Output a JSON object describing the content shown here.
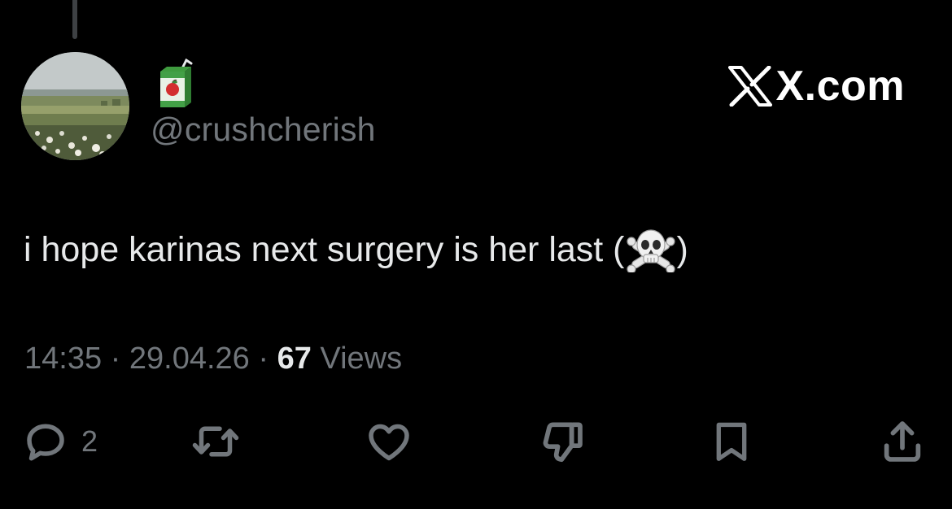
{
  "post": {
    "author": {
      "display_name_icon": "juice-box-emoji",
      "handle": "@crushcherish"
    },
    "brand": {
      "icon": "x-logo-icon",
      "text": "X.com"
    },
    "text_before": "i hope karinas next surgery is her last (",
    "text_emoji": "skull-and-crossbones-emoji",
    "text_after": ")",
    "time": "14:35",
    "separator": "·",
    "date": "29.04.26",
    "views_count": "67",
    "views_label": "Views"
  },
  "actions": {
    "reply": {
      "icon": "reply-bubble-icon",
      "count": "2"
    },
    "repost": {
      "icon": "repost-icon"
    },
    "like": {
      "icon": "heart-icon"
    },
    "dislike": {
      "icon": "thumbs-down-icon"
    },
    "bookmark": {
      "icon": "bookmark-icon"
    },
    "share": {
      "icon": "share-icon"
    }
  },
  "colors": {
    "background": "#000000",
    "primary_text": "#e7e9ea",
    "secondary_text": "#71767b",
    "thread_line": "#3e4144"
  }
}
